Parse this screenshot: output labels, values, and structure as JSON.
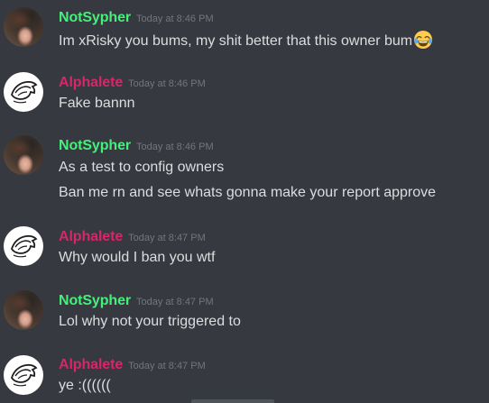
{
  "colors": {
    "background": "#36393f",
    "notsypher": "#43f17a",
    "alphalete": "#d8256b",
    "text": "#dcddde",
    "timestamp": "#72767d"
  },
  "messages": [
    {
      "author": "NotSypher",
      "avatar": "photo-avatar",
      "time": "Today at 8:46 PM",
      "lines": [
        "Im xRisky you bums, my shit better that this owner bum"
      ],
      "emoji": "joy-emoji"
    },
    {
      "author": "Alphalete",
      "avatar": "wolf-logo-avatar",
      "time": "Today at 8:46 PM",
      "lines": [
        "Fake bannn"
      ]
    },
    {
      "author": "NotSypher",
      "avatar": "photo-avatar",
      "time": "Today at 8:46 PM",
      "lines": [
        "As a test to config owners",
        "Ban me rn and see whats gonna make your report approve"
      ]
    },
    {
      "author": "Alphalete",
      "avatar": "wolf-logo-avatar",
      "time": "Today at 8:47 PM",
      "lines": [
        "Why would I ban you wtf"
      ]
    },
    {
      "author": "NotSypher",
      "avatar": "photo-avatar",
      "time": "Today at 8:47 PM",
      "lines": [
        "Lol why not your triggered to"
      ]
    },
    {
      "author": "Alphalete",
      "avatar": "wolf-logo-avatar",
      "time": "Today at 8:47 PM",
      "lines": [
        "ye :(((((("
      ]
    }
  ]
}
